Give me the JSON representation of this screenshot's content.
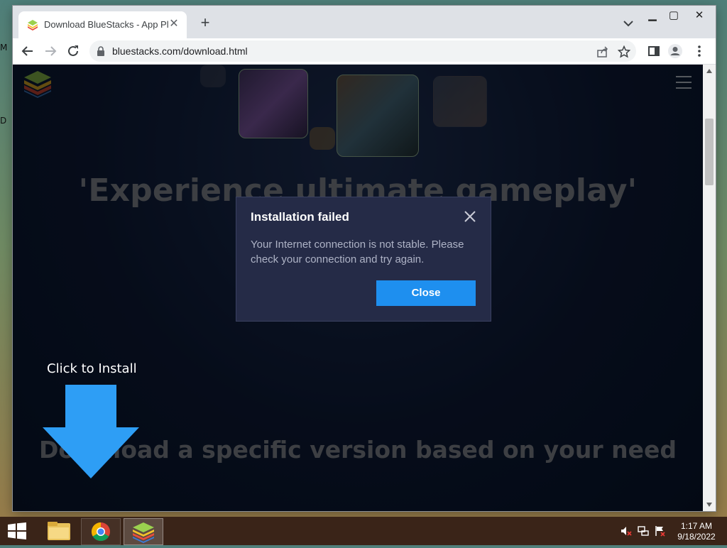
{
  "desktop": {
    "edge_label_1": "M",
    "edge_label_2": "D"
  },
  "browser": {
    "tab": {
      "title": "Download BlueStacks - App Player"
    },
    "url": "bluestacks.com/download.html"
  },
  "page": {
    "headline": "'Experience ultimate gameplay'",
    "subheadline": "Download a specific version based on your need",
    "click_to_install": "Click to Install"
  },
  "dialog": {
    "title": "Installation failed",
    "message": "Your Internet connection is not stable. Please check your connection and try again.",
    "button_label": "Close"
  },
  "taskbar": {
    "time": "1:17 AM",
    "date": "9/18/2022"
  },
  "colors": {
    "dialog_bg": "#252b47",
    "accent": "#1e8fef",
    "page_bg": "#0a1730"
  }
}
